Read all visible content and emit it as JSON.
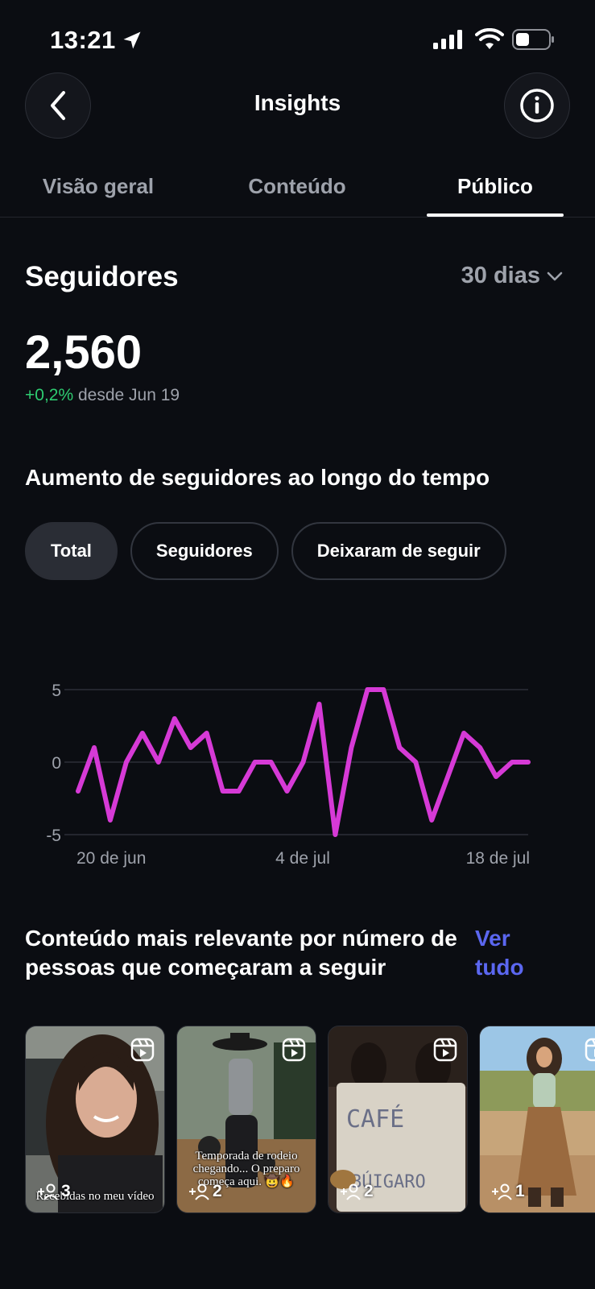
{
  "status": {
    "time": "13:21"
  },
  "header": {
    "title": "Insights"
  },
  "tabs": [
    {
      "label": "Visão geral",
      "active": false
    },
    {
      "label": "Conteúdo",
      "active": false
    },
    {
      "label": "Público",
      "active": true
    }
  ],
  "followers": {
    "title": "Seguidores",
    "range": "30 dias",
    "total": "2,560",
    "delta": "+0,2%",
    "delta_since": "desde Jun 19"
  },
  "growth": {
    "heading": "Aumento de seguidores ao longo do tempo",
    "filters": [
      {
        "label": "Total",
        "active": true
      },
      {
        "label": "Seguidores",
        "active": false
      },
      {
        "label": "Deixaram de seguir",
        "active": false
      }
    ]
  },
  "chart_data": {
    "type": "line",
    "y_ticks": [
      "5",
      "0",
      "-5"
    ],
    "x_ticks": [
      "20 de jun",
      "4 de jul",
      "18 de jul"
    ],
    "ylim": [
      -5,
      5
    ],
    "series": [
      {
        "color": "#d63ad6",
        "values": [
          -2,
          1,
          -4,
          0,
          2,
          0,
          3,
          1,
          2,
          -2,
          -2,
          0,
          0,
          -2,
          0,
          4,
          -5,
          1,
          5,
          5,
          1,
          0,
          -4,
          -1,
          2,
          1,
          -1,
          0,
          0
        ]
      }
    ]
  },
  "relevant": {
    "heading": "Conteúdo mais relevante por número de pessoas que começaram a seguir",
    "see_all": "Ver tudo",
    "items": [
      {
        "caption": "Recebidas no meu vídeo",
        "count": "3",
        "type": "reel"
      },
      {
        "caption": "Temporada de rodeio chegando... O preparo começa aqui. 🤠🔥",
        "count": "2",
        "type": "reel"
      },
      {
        "caption": "",
        "count": "2",
        "type": "reel"
      },
      {
        "caption": "",
        "count": "1",
        "type": "reel"
      }
    ]
  },
  "colors": {
    "accent_link": "#5b67f0",
    "positive": "#2ecc71",
    "series": "#d63ad6"
  }
}
